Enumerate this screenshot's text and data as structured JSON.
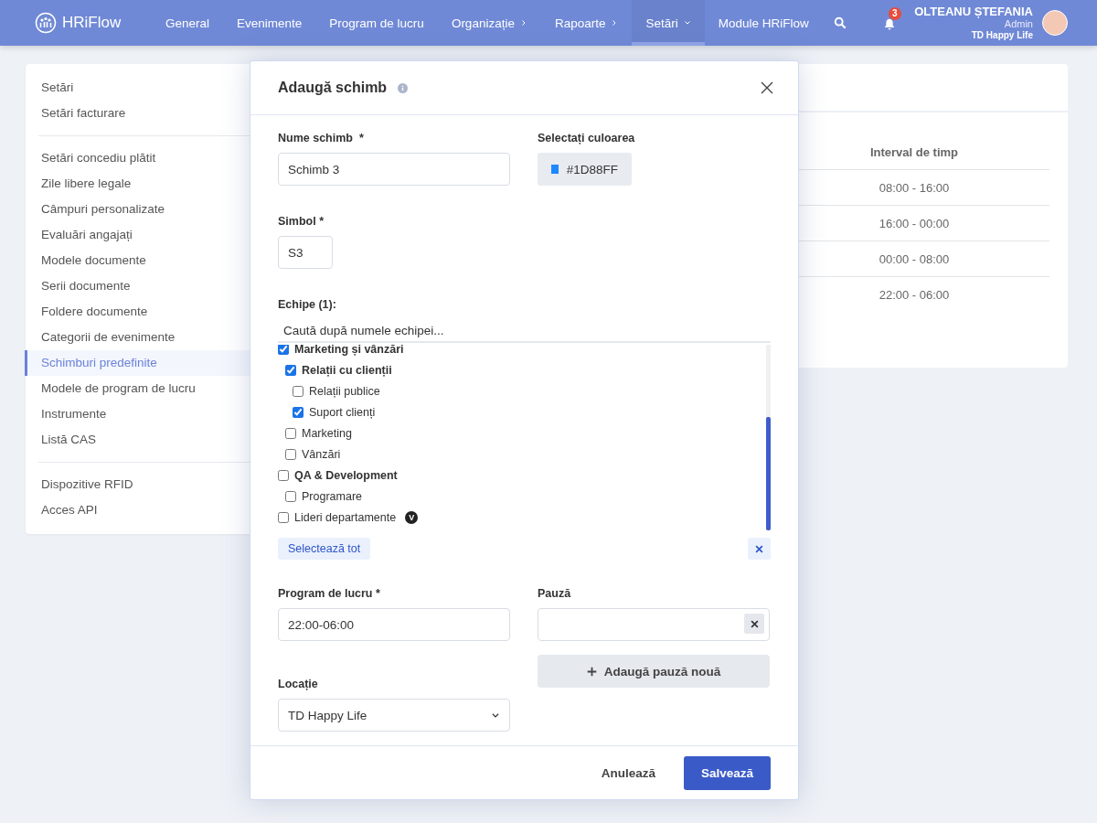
{
  "header": {
    "logo": "HRiFlow",
    "nav": [
      {
        "label": "General",
        "selected": false,
        "kind": "link"
      },
      {
        "label": "Evenimente",
        "selected": false,
        "kind": "link"
      },
      {
        "label": "Program de lucru",
        "selected": false,
        "kind": "link"
      },
      {
        "label": "Organizație",
        "selected": false,
        "kind": "submenu"
      },
      {
        "label": "Rapoarte",
        "selected": false,
        "kind": "submenu"
      },
      {
        "label": "Setări",
        "selected": true,
        "kind": "dropdown"
      },
      {
        "label": "Module HRiFlow",
        "selected": false,
        "kind": "link"
      }
    ],
    "notifications": "3",
    "user": {
      "name": "OLTEANU ȘTEFANIA",
      "role": "Admin",
      "company": "TD Happy Life"
    }
  },
  "sidebar": {
    "groups": [
      [
        {
          "label": "Setări",
          "selected": false
        },
        {
          "label": "Setări facturare",
          "selected": false
        }
      ],
      [
        {
          "label": "Setări concediu plătit",
          "selected": false
        },
        {
          "label": "Zile libere legale",
          "selected": false
        },
        {
          "label": "Câmpuri personalizate",
          "selected": false
        },
        {
          "label": "Evaluări angajați",
          "selected": false
        },
        {
          "label": "Modele documente",
          "selected": false
        },
        {
          "label": "Serii documente",
          "selected": false
        },
        {
          "label": "Foldere documente",
          "selected": false
        },
        {
          "label": "Categorii de evenimente",
          "selected": false
        },
        {
          "label": "Schimburi predefinite",
          "selected": true
        },
        {
          "label": "Modele de program de lucru",
          "selected": false
        },
        {
          "label": "Instrumente",
          "selected": false
        },
        {
          "label": "Listă CAS",
          "selected": false
        }
      ],
      [
        {
          "label": "Dispozitive RFID",
          "selected": false
        },
        {
          "label": "Acces API",
          "selected": false
        }
      ]
    ]
  },
  "table": {
    "column": "Interval de timp",
    "rows": [
      "08:00 - 16:00",
      "16:00 - 00:00",
      "00:00 - 08:00",
      "22:00 - 06:00"
    ]
  },
  "modal": {
    "title": "Adaugă schimb",
    "name": {
      "label": "Nume schimb  *",
      "value": "Schimb 3"
    },
    "color": {
      "label": "Selectați culoarea",
      "value": "#1D88FF"
    },
    "symbol": {
      "label": "Simbol *",
      "value": "S3"
    },
    "teams": {
      "label": "Echipe (1):",
      "placeholder": "Caută după numele echipei...",
      "tree": [
        {
          "label": "Marketing și vânzări",
          "checked": true,
          "children": [
            {
              "label": "Relații cu clienții",
              "checked": true,
              "children": [
                {
                  "label": "Relații publice",
                  "checked": false
                },
                {
                  "label": "Suport clienți",
                  "checked": true
                }
              ]
            },
            {
              "label": "Marketing",
              "checked": false
            },
            {
              "label": "Vânzări",
              "checked": false
            }
          ]
        },
        {
          "label": "QA & Development",
          "checked": false,
          "children": [
            {
              "label": "Programare",
              "checked": false
            }
          ]
        },
        {
          "label": "Lideri departamente",
          "checked": false,
          "badge": "V"
        }
      ],
      "select_all": "Selectează tot"
    },
    "schedule": {
      "label": "Program de lucru *",
      "value": "22:00-06:00"
    },
    "pause": {
      "label": "Pauză",
      "add_button": "Adaugă pauză nouă"
    },
    "location": {
      "label": "Locație",
      "value": "TD Happy Life"
    },
    "cancel": "Anulează",
    "save": "Salvează"
  }
}
